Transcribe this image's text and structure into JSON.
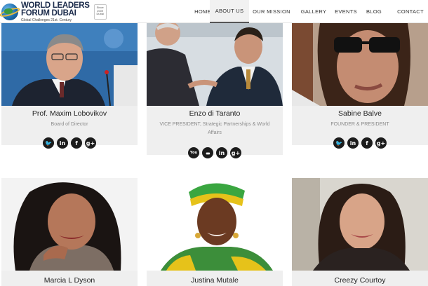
{
  "header": {
    "logo": {
      "line1": "WORLD LEADERS",
      "line2": "FORUM DUBAI",
      "tagline": "Global Challenges 21st. Century",
      "badge": "Since 2009 Dubai"
    },
    "nav": [
      {
        "label": "HOME"
      },
      {
        "label": "ABOUT US",
        "active": true
      },
      {
        "label": "OUR MISSION"
      },
      {
        "label": "GALLERY"
      },
      {
        "label": "EVENTS"
      },
      {
        "label": "BLOG"
      },
      {
        "label": "CONTACT"
      }
    ]
  },
  "members": [
    {
      "name": "Prof. Maxim Lobovikov",
      "role": "Board of Director",
      "socials": [
        "twitter-icon",
        "linkedin-icon",
        "facebook-icon",
        "google-plus-icon"
      ]
    },
    {
      "name": "Enzo di Taranto",
      "role": "VICE PRESIDENT, Strategic Partnerships & World Affairs",
      "socials": [
        "youtube-icon",
        "flickr-icon",
        "linkedin-icon",
        "google-plus-icon"
      ]
    },
    {
      "name": "Sabine Balve",
      "role": "FOUNDER & PRESIDENT",
      "socials": [
        "twitter-icon",
        "linkedin-icon",
        "facebook-icon",
        "google-plus-icon"
      ]
    },
    {
      "name": "Marcia L Dyson"
    },
    {
      "name": "Justina Mutale"
    },
    {
      "name": "Creezy Courtoy"
    }
  ],
  "icons": {
    "twitter": "🐦",
    "linkedin": "in",
    "facebook": "f",
    "google_plus": "g+",
    "youtube": "You",
    "flickr": "●●"
  }
}
